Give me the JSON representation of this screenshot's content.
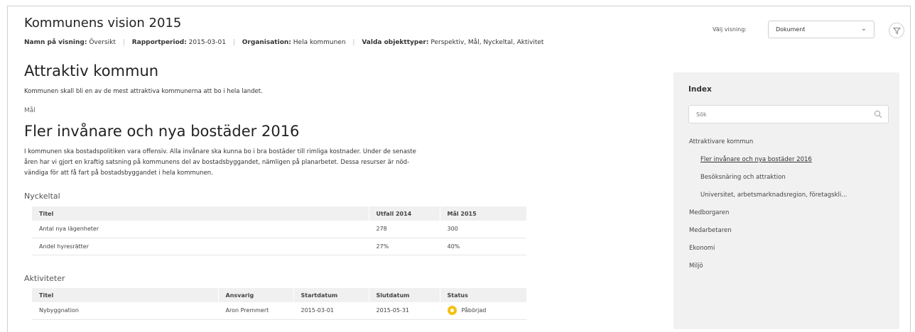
{
  "header": {
    "title": "Kommunens vision 2015",
    "meta": [
      {
        "key": "Namn på visning:",
        "value": "Översikt"
      },
      {
        "key": "Rapportperiod:",
        "value": "2015-03-01"
      },
      {
        "key": "Organisation:",
        "value": "Hela kommunen"
      },
      {
        "key": "Valda objekttyper:",
        "value": "Perspektiv, Mål, Nyckeltal, Aktivitet"
      }
    ],
    "view_label": "Välj visning:",
    "view_selected": "Dokument",
    "filter_icon": "filter-icon"
  },
  "section": {
    "title": "Attraktiv kommun",
    "description": "Kommunen skall bli en av de mest attraktiva kommunerna att bo i hela landet."
  },
  "goal": {
    "tag": "Mål",
    "title": "Fler invånare och nya bostäder 2016",
    "description_lines": [
      "I kommunen ska bostadspolitiken vara offensiv. Alla invånare ska kunna bo i bra bostäder till rimliga kostnader. Under de senaste",
      "åren har vi gjort en kraftig satsning på kommunens del av bostadsbyggandet, nämligen på planarbetet. Dessa resurser är nöd-",
      "vändiga för att få fart på bostadsbyggandet i hela kommunen."
    ]
  },
  "kpis": {
    "heading": "Nyckeltal",
    "columns": [
      "Titel",
      "Utfall 2014",
      "Mål 2015"
    ],
    "rows": [
      [
        "Antal nya lägenheter",
        "278",
        "300"
      ],
      [
        "Andel hyresrätter",
        "27%",
        "40%"
      ]
    ]
  },
  "activities": {
    "heading": "Aktiviteter",
    "columns": [
      "Titel",
      "Ansvarig",
      "Startdatum",
      "Slutdatum",
      "Status"
    ],
    "rows": [
      [
        "Nybyggnation",
        "Aron Premmert",
        "2015-03-01",
        "2015-05-31",
        "Påbörjad"
      ]
    ],
    "status_color": "#f5c211"
  },
  "index": {
    "title": "Index",
    "search_placeholder": "Sök",
    "items": [
      {
        "label": "Attraktivare kommun",
        "child": false,
        "active": false
      },
      {
        "label": "Fler invånare och nya bostäder 2016",
        "child": true,
        "active": true
      },
      {
        "label": "Besöksnäring och attraktion",
        "child": true,
        "active": false
      },
      {
        "label": "Universitet, arbetsmarknadsregion, företagskli...",
        "child": true,
        "active": false
      },
      {
        "label": "Medborgaren",
        "child": false,
        "active": false
      },
      {
        "label": "Medarbetaren",
        "child": false,
        "active": false
      },
      {
        "label": "Ekonomi",
        "child": false,
        "active": false
      },
      {
        "label": "Miljö",
        "child": false,
        "active": false
      }
    ]
  }
}
